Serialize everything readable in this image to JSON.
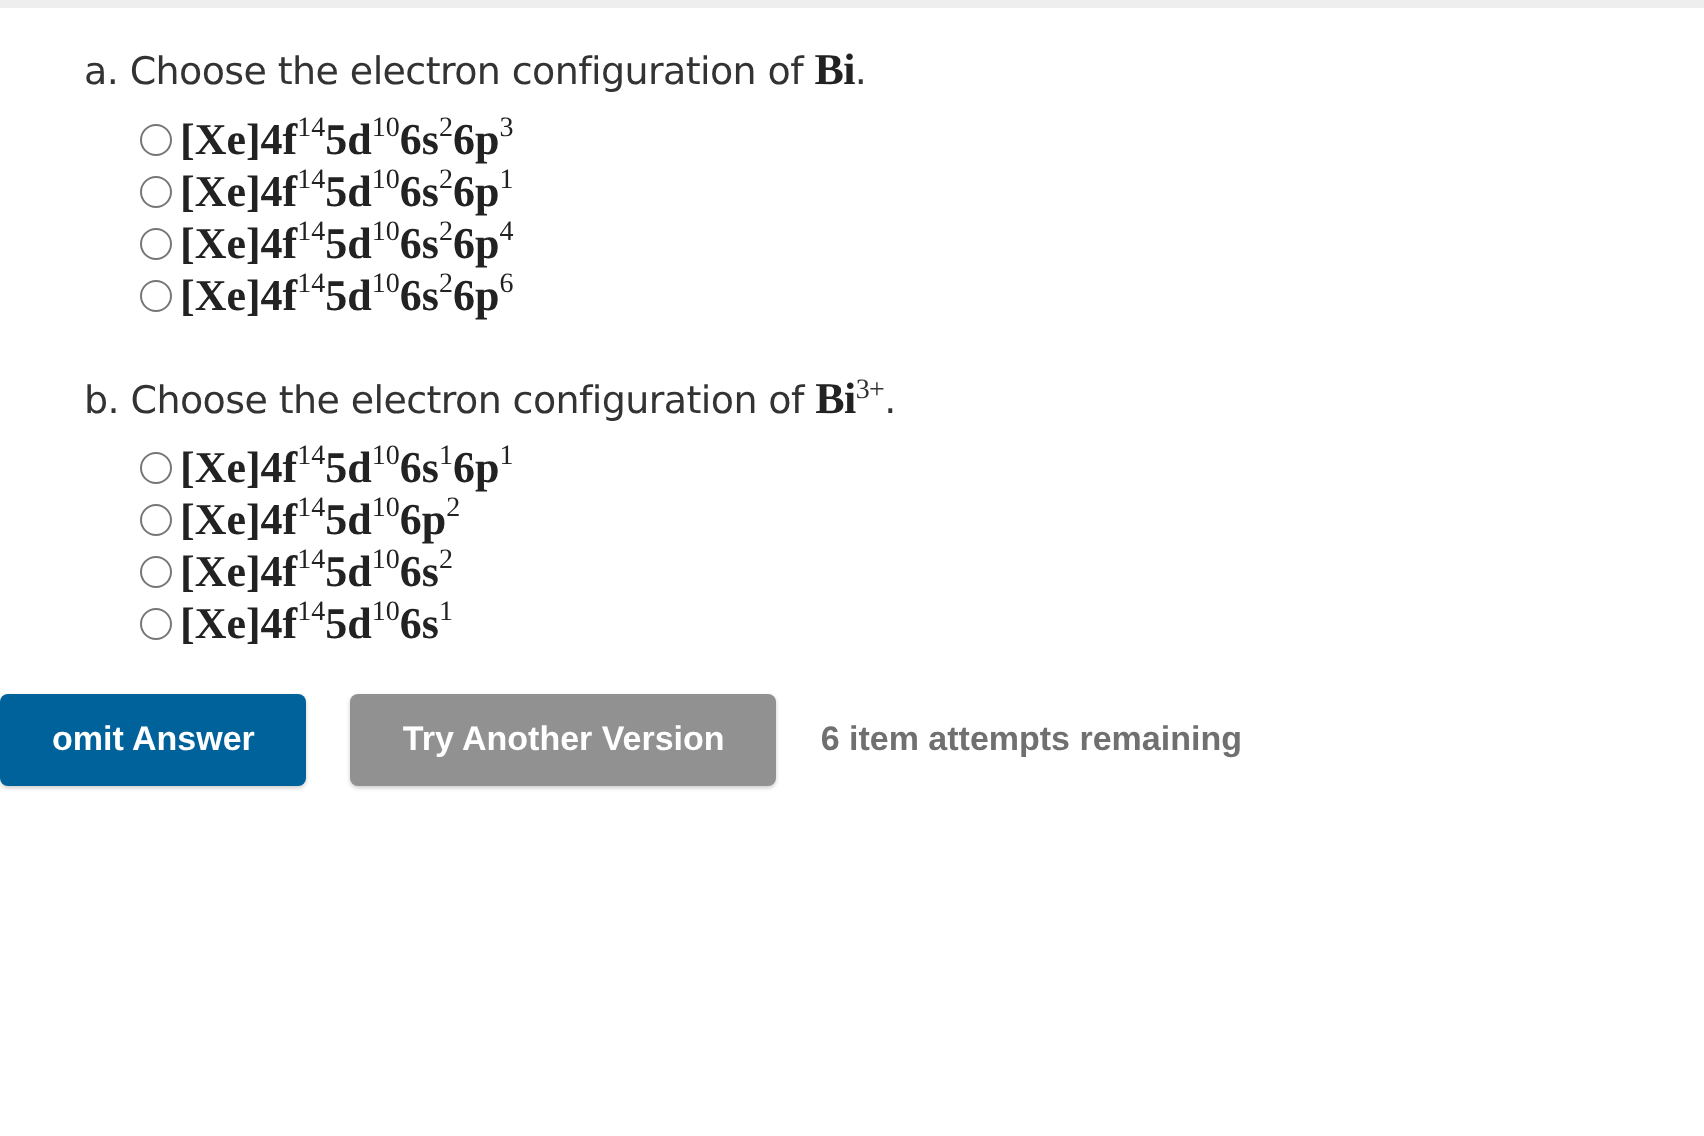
{
  "questions": [
    {
      "prompt": "a. Choose the electron configuration of **Bi**.",
      "options": [
        {
          "text": "[Xe]4f$^{14}$5d$^{10}$6s$^{2}$6p$^{3}$",
          "selected": false
        },
        {
          "text": "[Xe]4f$^{14}$5d$^{10}$6s$^{2}$6p$^{1}$",
          "selected": false
        },
        {
          "text": "[Xe]4f$^{14}$5d$^{10}$6s$^{2}$6p$^{4}$",
          "selected": false
        },
        {
          "text": "[Xe]4f$^{14}$5d$^{10}$6s$^{2}$6p$^{6}$",
          "selected": false
        }
      ]
    },
    {
      "prompt": "b. Choose the electron configuration of **Bi**$^{3+}$.",
      "options": [
        {
          "text": "[Xe]4f$^{14}$5d$^{10}$6s$^{1}$6p$^{1}$",
          "selected": false
        },
        {
          "text": "[Xe]4f$^{14}$5d$^{10}$6p$^{2}$",
          "selected": false
        },
        {
          "text": "[Xe]4f$^{14}$5d$^{10}$6s$^{2}$",
          "selected": false
        },
        {
          "text": "[Xe]4f$^{14}$5d$^{10}$6s$^{1}$",
          "selected": false
        }
      ]
    }
  ],
  "buttons": [
    {
      "label": "omit Answer",
      "kind": "primary"
    },
    {
      "label": "Try Another Version",
      "kind": "secondary"
    }
  ],
  "attempts": "6 item attempts remaining"
}
